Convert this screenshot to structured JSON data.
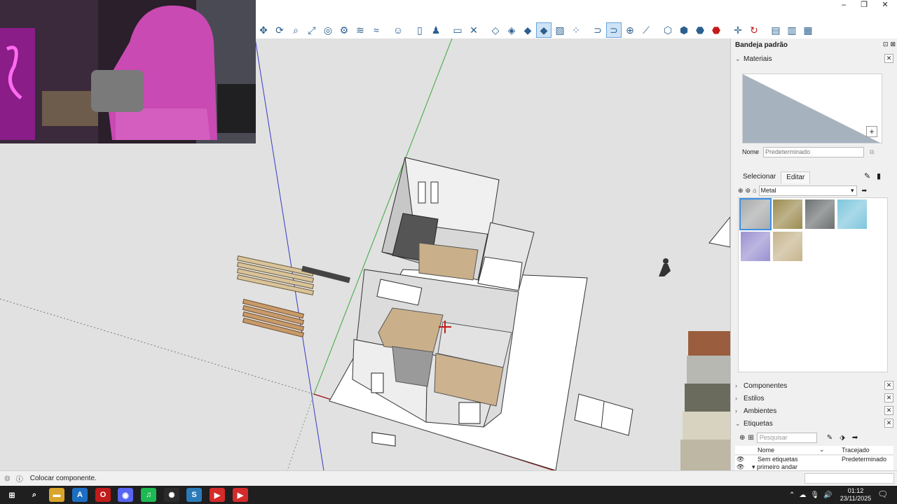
{
  "window": {
    "minimize": "–",
    "restore": "❐",
    "close": "✕"
  },
  "toolbar": {
    "icons": [
      "move-icon",
      "rotate-icon",
      "zoom-icon",
      "zoom-extents-icon",
      "section-plane-icon",
      "section-cut-icon",
      "section-fill-icon",
      "display-section-icon",
      "user-icon",
      "new-page-icon",
      "person-icon",
      "rectangle-select-icon",
      "delete-icon",
      "water-drop-icon",
      "water-drop-half-icon",
      "water-drop-filled-icon",
      "water-drop-active-icon",
      "pattern-icon",
      "grid-dots-icon",
      "magnet-icon",
      "magnet-active-icon",
      "add-circle-icon",
      "measure-icon",
      "box-icon",
      "box-outline-icon",
      "box-solid-icon",
      "box-red-icon",
      "crosshair-icon",
      "refresh-icon",
      "layers-icon",
      "layers-2-icon",
      "layers-3-icon"
    ]
  },
  "tray": {
    "title": "Bandeja padrão",
    "materials": {
      "header": "Materiais",
      "name_label": "Nome",
      "name_placeholder": "Predeterminado",
      "tab_select": "Selecionar",
      "tab_edit": "Editar",
      "library": "Metal",
      "swatches": [
        {
          "name": "metal-brushed",
          "color": "#a9aaab"
        },
        {
          "name": "metal-gold",
          "color": "#9c8b4f"
        },
        {
          "name": "metal-dark",
          "color": "#6d7172"
        },
        {
          "name": "metal-blue-mesh",
          "color": "#7ec6dd"
        },
        {
          "name": "metal-purple-mesh",
          "color": "#9a91d1"
        },
        {
          "name": "metal-tan-mesh",
          "color": "#c6b48d"
        }
      ]
    },
    "sections": {
      "components": "Componentes",
      "styles": "Estilos",
      "environments": "Ambientes",
      "tags": "Etiquetas"
    },
    "tags": {
      "search_placeholder": "Pesquisar",
      "col_name": "Nome",
      "col_dash": "Tracejado",
      "rows": [
        {
          "name": "Sem etiquetas",
          "dash": "Predeterminado"
        },
        {
          "name": "▾ primeiro andar",
          "dash": ""
        }
      ]
    }
  },
  "status": {
    "message": "Colocar componente."
  },
  "taskbar": {
    "apps": [
      {
        "name": "start",
        "label": "⊞",
        "color": "#1f1f1f"
      },
      {
        "name": "search",
        "label": "⌕",
        "color": "#1f1f1f"
      },
      {
        "name": "explorer",
        "label": "▬",
        "color": "#d9a52b"
      },
      {
        "name": "app-a",
        "label": "A",
        "color": "#1d6fc4"
      },
      {
        "name": "opera",
        "label": "O",
        "color": "#c21b1b"
      },
      {
        "name": "discord",
        "label": "◉",
        "color": "#5865f2"
      },
      {
        "name": "spotify",
        "label": "♫",
        "color": "#1db954"
      },
      {
        "name": "chatgpt",
        "label": "✺",
        "color": "#2b2b2b"
      },
      {
        "name": "sketchup",
        "label": "S",
        "color": "#2b7bb9"
      },
      {
        "name": "youtube-1",
        "label": "▶",
        "color": "#d42b2b"
      },
      {
        "name": "youtube-2",
        "label": "▶",
        "color": "#d42b2b"
      }
    ],
    "time": "01:12",
    "date": "23/11/2025"
  }
}
